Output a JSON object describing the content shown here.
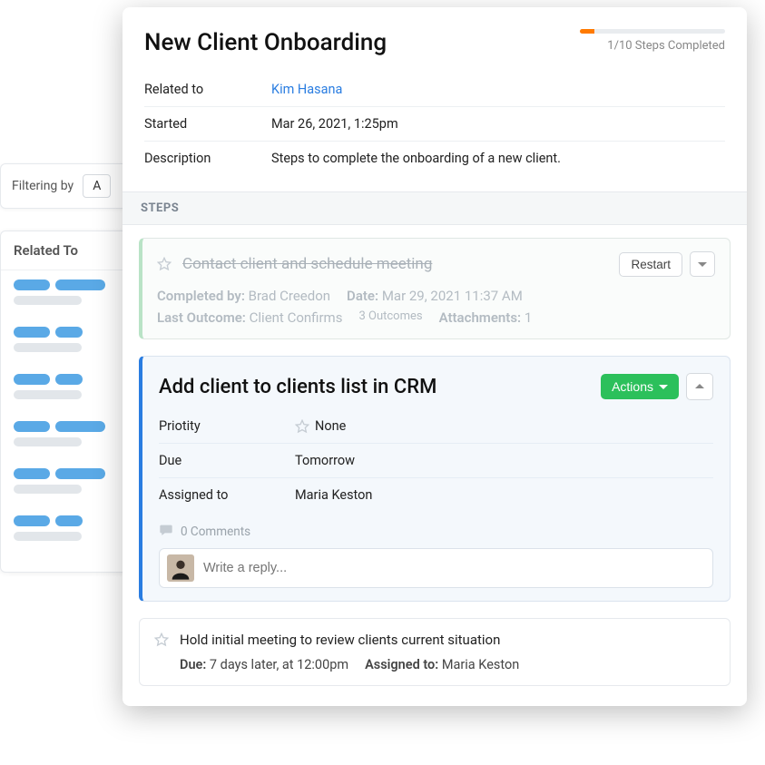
{
  "filter": {
    "label": "Filtering by",
    "value": "A"
  },
  "related_panel": {
    "header": "Related To"
  },
  "onboarding": {
    "title": "New Client Onboarding",
    "progress": {
      "label": "1/10 Steps Completed",
      "percent": 10
    },
    "meta": {
      "related_to_key": "Related to",
      "related_to_val": "Kim Hasana",
      "started_key": "Started",
      "started_val": "Mar 26, 2021, 1:25pm",
      "description_key": "Description",
      "description_val": "Steps to complete the onboarding of a new client."
    },
    "steps_header": "STEPS",
    "completed": {
      "title": "Contact client and schedule meeting",
      "restart_label": "Restart",
      "completed_by_key": "Completed by:",
      "completed_by_val": "Brad Creedon",
      "date_key": "Date:",
      "date_val": "Mar 29, 2021 11:37 AM",
      "last_outcome_key": "Last Outcome:",
      "last_outcome_val": "Client Confirms",
      "outcomes_count": "3 Outcomes",
      "attachments_key": "Attachments:",
      "attachments_val": "1"
    },
    "active": {
      "title": "Add client to clients list in CRM",
      "actions_label": "Actions",
      "priority_key": "Priotity",
      "priority_val": "None",
      "due_key": "Due",
      "due_val": "Tomorrow",
      "assigned_key": "Assigned to",
      "assigned_val": "Maria Keston",
      "comments_label": "0 Comments",
      "reply_placeholder": "Write a reply..."
    },
    "upcoming": {
      "title": "Hold initial meeting to review clients current situation",
      "due_key": "Due:",
      "due_val": "7 days later, at 12:00pm",
      "assigned_key": "Assigned to:",
      "assigned_val": "Maria Keston"
    }
  }
}
